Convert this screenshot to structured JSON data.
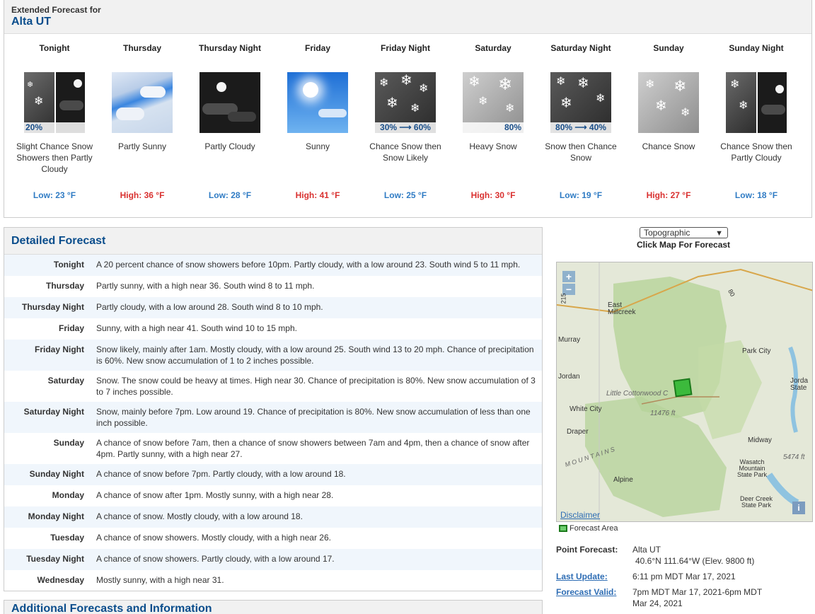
{
  "header": {
    "title": "Extended Forecast for",
    "location": "Alta UT"
  },
  "periods": [
    {
      "name": "Tonight",
      "short_desc": "Slight Chance Snow Showers then Partly Cloudy",
      "pop": "20%",
      "temp": "Low: 23 °F",
      "icon": "snow-showers-then-night-icon"
    },
    {
      "name": "Thursday",
      "short_desc": "Partly Sunny",
      "pop": "",
      "temp": "High: 36 °F",
      "icon": "partly-sunny-icon"
    },
    {
      "name": "Thursday Night",
      "short_desc": "Partly Cloudy",
      "pop": "",
      "temp": "Low: 28 °F",
      "icon": "partly-cloudy-night-icon"
    },
    {
      "name": "Friday",
      "short_desc": "Sunny",
      "pop": "",
      "temp": "High: 41 °F",
      "icon": "sunny-icon"
    },
    {
      "name": "Friday Night",
      "short_desc": "Chance Snow then Snow Likely",
      "pop": "30% ⟶ 60%",
      "temp": "Low: 25 °F",
      "icon": "snow-icon"
    },
    {
      "name": "Saturday",
      "short_desc": "Heavy Snow",
      "pop": "80%",
      "temp": "High: 30 °F",
      "icon": "heavy-snow-icon"
    },
    {
      "name": "Saturday Night",
      "short_desc": "Snow then Chance Snow",
      "pop": "80% ⟶ 40%",
      "temp": "Low: 19 °F",
      "icon": "snow-icon"
    },
    {
      "name": "Sunday",
      "short_desc": "Chance Snow",
      "pop": "",
      "temp": "High: 27 °F",
      "icon": "chance-snow-icon"
    },
    {
      "name": "Sunday Night",
      "short_desc": "Chance Snow then Partly Cloudy",
      "pop": "",
      "temp": "Low: 18 °F",
      "icon": "snow-then-night-icon"
    }
  ],
  "detailed": {
    "title": "Detailed Forecast",
    "rows": [
      {
        "label": "Tonight",
        "text": "A 20 percent chance of snow showers before 10pm. Partly cloudy, with a low around 23. South wind 5 to 11 mph."
      },
      {
        "label": "Thursday",
        "text": "Partly sunny, with a high near 36. South wind 8 to 11 mph."
      },
      {
        "label": "Thursday Night",
        "text": "Partly cloudy, with a low around 28. South wind 8 to 10 mph."
      },
      {
        "label": "Friday",
        "text": "Sunny, with a high near 41. South wind 10 to 15 mph."
      },
      {
        "label": "Friday Night",
        "text": "Snow likely, mainly after 1am. Mostly cloudy, with a low around 25. South wind 13 to 20 mph. Chance of precipitation is 60%. New snow accumulation of 1 to 2 inches possible."
      },
      {
        "label": "Saturday",
        "text": "Snow. The snow could be heavy at times. High near 30. Chance of precipitation is 80%. New snow accumulation of 3 to 7 inches possible."
      },
      {
        "label": "Saturday Night",
        "text": "Snow, mainly before 7pm. Low around 19. Chance of precipitation is 80%. New snow accumulation of less than one inch possible."
      },
      {
        "label": "Sunday",
        "text": "A chance of snow before 7am, then a chance of snow showers between 7am and 4pm, then a chance of snow after 4pm. Partly sunny, with a high near 27."
      },
      {
        "label": "Sunday Night",
        "text": "A chance of snow before 7pm. Partly cloudy, with a low around 18."
      },
      {
        "label": "Monday",
        "text": "A chance of snow after 1pm. Mostly sunny, with a high near 28."
      },
      {
        "label": "Monday Night",
        "text": "A chance of snow. Mostly cloudy, with a low around 18."
      },
      {
        "label": "Tuesday",
        "text": "A chance of snow showers. Mostly cloudy, with a high near 26."
      },
      {
        "label": "Tuesday Night",
        "text": "A chance of snow showers. Partly cloudy, with a low around 17."
      },
      {
        "label": "Wednesday",
        "text": "Mostly sunny, with a high near 31."
      }
    ]
  },
  "additional": {
    "title": "Additional Forecasts and Information"
  },
  "map": {
    "select_value": "Topographic",
    "caption": "Click Map For Forecast",
    "zoom_in": "+",
    "zoom_out": "−",
    "disclaimer": "Disclaimer",
    "info": "i",
    "legend": "Forecast Area",
    "labels": {
      "east_millcreek": "East Millcreek",
      "murray": "Murray",
      "park_city": "Park City",
      "jordan": "Jordan",
      "jordanelle": "Jorda State",
      "white_city": "White City",
      "elev1": "11476 ft",
      "little_cottonwood": "Little Cottonwood C",
      "draper": "Draper",
      "midway": "Midway",
      "elev2": "5474 ft",
      "wasatch_park": "Wasatch Mountain State Park",
      "mountains": "M O U N T A I N S",
      "alpine": "Alpine",
      "deer_creek": "Deer Creek State Park",
      "road_80": "80",
      "road_215": "215"
    }
  },
  "point_forecast": {
    "label": "Point Forecast:",
    "name": "Alta UT",
    "coords": "40.6°N 111.64°W (Elev. 9800 ft)",
    "last_update_label": "Last Update",
    "last_update": "6:11 pm MDT Mar 17, 2021",
    "valid_label": "Forecast Valid",
    "valid": "7pm MDT Mar 17, 2021-6pm MDT Mar 24, 2021"
  },
  "colors": {
    "link": "#2e6db4",
    "header": "#0a4d8c",
    "low": "#2f7bc4",
    "high": "#d9302f"
  }
}
